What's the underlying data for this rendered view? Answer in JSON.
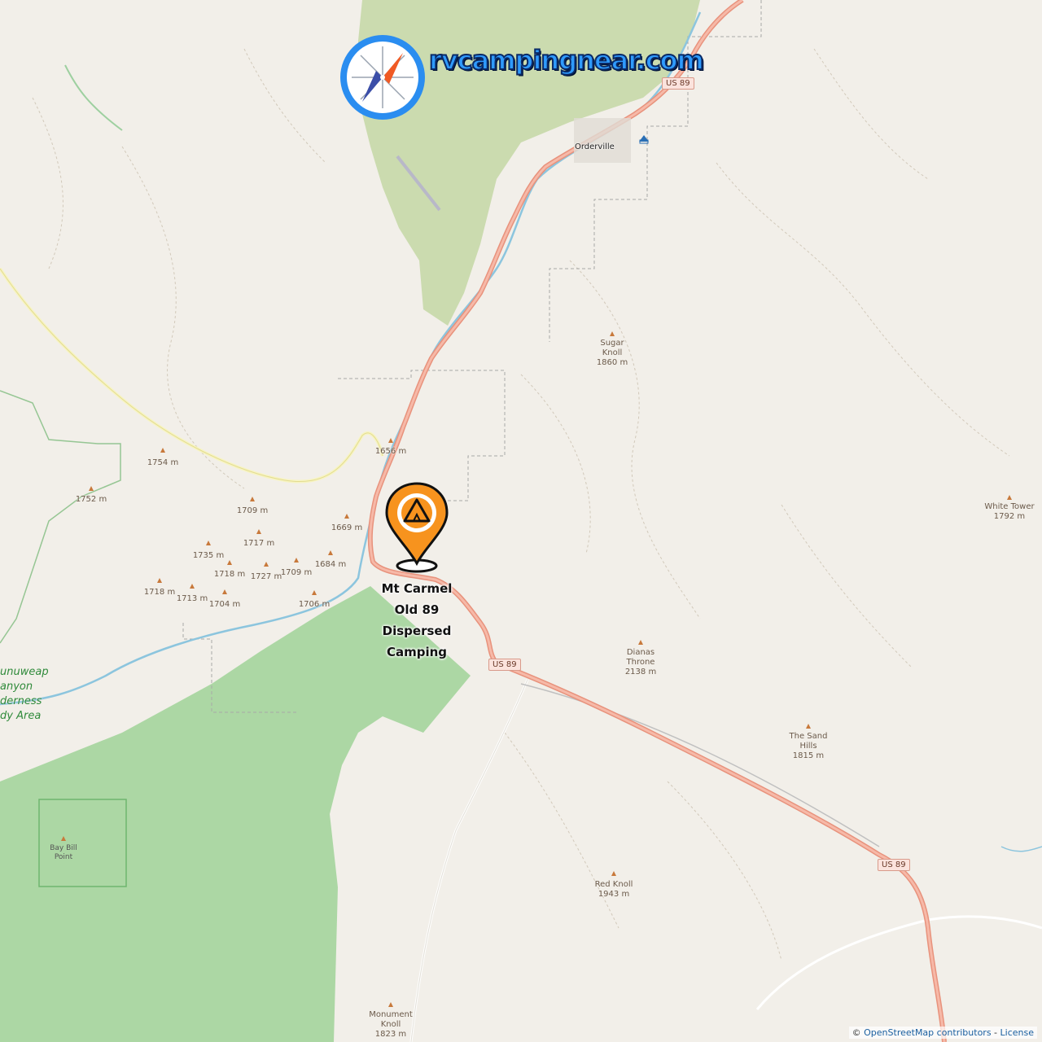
{
  "brand": {
    "text": "rvcampingnear.com"
  },
  "camp": {
    "name_lines": [
      "Mt Carmel",
      "Old 89",
      "Dispersed",
      "Camping"
    ],
    "pin_color": "#f7931e"
  },
  "town": {
    "name": "Orderville"
  },
  "highway_shields": [
    {
      "label": "US 89"
    },
    {
      "label": "US 89"
    },
    {
      "label": "US 89"
    }
  ],
  "peaks": [
    {
      "lines": [
        "Sugar",
        "Knoll",
        "1860 m"
      ]
    },
    {
      "lines": [
        "1656 m"
      ]
    },
    {
      "lines": [
        "1754 m"
      ]
    },
    {
      "lines": [
        "1752 m"
      ]
    },
    {
      "lines": [
        "1709 m"
      ]
    },
    {
      "lines": [
        "1669 m"
      ]
    },
    {
      "lines": [
        "1717 m"
      ]
    },
    {
      "lines": [
        "1735 m"
      ]
    },
    {
      "lines": [
        "1684 m"
      ]
    },
    {
      "lines": [
        "1718 m"
      ]
    },
    {
      "lines": [
        "1727 m"
      ]
    },
    {
      "lines": [
        "1709 m"
      ]
    },
    {
      "lines": [
        "1718 m"
      ]
    },
    {
      "lines": [
        "1713 m"
      ]
    },
    {
      "lines": [
        "1704 m"
      ]
    },
    {
      "lines": [
        "1706 m"
      ]
    },
    {
      "lines": [
        "White Tower",
        "1792 m"
      ]
    },
    {
      "lines": [
        "Dianas",
        "Throne",
        "2138 m"
      ]
    },
    {
      "lines": [
        "The Sand",
        "Hills",
        "1815 m"
      ]
    },
    {
      "lines": [
        "Red Knoll",
        "1943 m"
      ]
    },
    {
      "lines": [
        "Monument",
        "Knoll",
        "1823 m"
      ]
    }
  ],
  "wilderness": {
    "lines": [
      "unuweap",
      "anyon",
      "derness",
      "dy Area"
    ]
  },
  "bay_bill": {
    "lines": [
      "Bay Bill",
      "Point"
    ]
  },
  "attribution": {
    "prefix": "© ",
    "link": "OpenStreetMap contributors",
    "sep": " - ",
    "license": "License"
  },
  "colors": {
    "background": "#f2efe9",
    "forest": "#add19e",
    "wood": "#9fcf8d",
    "highway": "#e8927c",
    "river": "#aad3df"
  }
}
